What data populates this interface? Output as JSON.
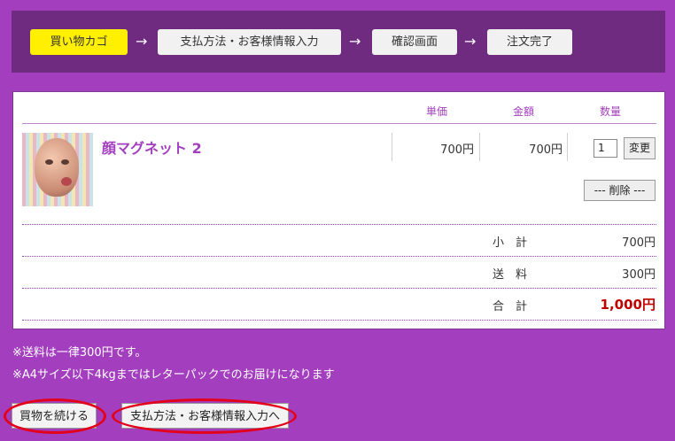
{
  "steps": [
    "買い物カゴ",
    "支払方法・お客様情報入力",
    "確認画面",
    "注文完了"
  ],
  "arrow": "→",
  "columns": {
    "unit_price": "単価",
    "amount": "金額",
    "quantity": "数量"
  },
  "item": {
    "name": "顔マグネット 2",
    "unit_price": "700円",
    "amount": "700円",
    "quantity": "1",
    "change_label": "変更",
    "delete_label": "--- 削除 ---"
  },
  "summary": {
    "subtotal_label": "小　計",
    "subtotal": "700円",
    "shipping_label": "送　料",
    "shipping": "300円",
    "total_label": "合　計",
    "total": "1,000円"
  },
  "notes": [
    "※送料は一律300円です。",
    "※A4サイズ以下4kgまではレターパックでのお届けになります"
  ],
  "buttons": {
    "continue": "買物を続ける",
    "checkout": "支払方法・お客様情報入力へ"
  },
  "colors": {
    "background": "#a33fbe",
    "header": "#6e2b80",
    "active_step": "#ffef00",
    "total": "#c00000",
    "highlight": "#e3001b"
  },
  "icons": [
    "product-image"
  ]
}
